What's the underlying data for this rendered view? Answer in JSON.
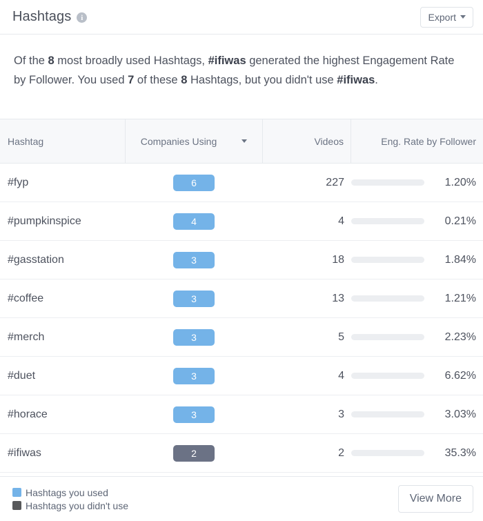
{
  "header": {
    "title": "Hashtags",
    "info_icon": "info-icon",
    "export_label": "Export",
    "export_caret": "chevron-down-icon"
  },
  "summary": {
    "part1": "Of the ",
    "count_total": "8",
    "part2": " most broadly used Hashtags, ",
    "top_hashtag": "#ifiwas",
    "part3": " generated the highest Engagement Rate by Follower. You used ",
    "count_used": "7",
    "part4": " of these ",
    "count_total2": "8",
    "part5": " Hashtags, but you didn't use ",
    "unused_hashtag": "#ifiwas",
    "part6": "."
  },
  "table": {
    "columns": [
      {
        "key": "hashtag",
        "label": "Hashtag"
      },
      {
        "key": "companies",
        "label": "Companies Using",
        "sorted": true,
        "sort_icon": "caret-down-icon"
      },
      {
        "key": "videos",
        "label": "Videos"
      },
      {
        "key": "eng",
        "label": "Eng. Rate by Follower"
      }
    ],
    "rows": [
      {
        "hashtag": "#fyp",
        "companies": "6",
        "used": true,
        "videos": "227",
        "eng": "1.20%",
        "eng_value": 1.2
      },
      {
        "hashtag": "#pumpkinspice",
        "companies": "4",
        "used": true,
        "videos": "4",
        "eng": "0.21%",
        "eng_value": 0.21
      },
      {
        "hashtag": "#gasstation",
        "companies": "3",
        "used": true,
        "videos": "18",
        "eng": "1.84%",
        "eng_value": 1.84
      },
      {
        "hashtag": "#coffee",
        "companies": "3",
        "used": true,
        "videos": "13",
        "eng": "1.21%",
        "eng_value": 1.21
      },
      {
        "hashtag": "#merch",
        "companies": "3",
        "used": true,
        "videos": "5",
        "eng": "2.23%",
        "eng_value": 2.23
      },
      {
        "hashtag": "#duet",
        "companies": "3",
        "used": true,
        "videos": "4",
        "eng": "6.62%",
        "eng_value": 6.62
      },
      {
        "hashtag": "#horace",
        "companies": "3",
        "used": true,
        "videos": "3",
        "eng": "3.03%",
        "eng_value": 3.03
      },
      {
        "hashtag": "#ifiwas",
        "companies": "2",
        "used": false,
        "videos": "2",
        "eng": "35.3%",
        "eng_value": 35.3
      }
    ],
    "eng_max": 35.3
  },
  "footer": {
    "legend": [
      {
        "label": "Hashtags you used",
        "color": "#74b3e8"
      },
      {
        "label": "Hashtags you didn't use",
        "color": "#58595b"
      }
    ],
    "view_more_label": "View More"
  },
  "colors": {
    "badge_used": "#74b3e8",
    "badge_unused": "#6b7285",
    "bar_fill": "#5c6377",
    "bar_track": "#eceef1",
    "text": "#4d525e",
    "header_bg": "#f7f8fa",
    "border": "#e6e9ed"
  },
  "chart_data": {
    "type": "bar",
    "title": "Eng. Rate by Follower",
    "categories": [
      "#fyp",
      "#pumpkinspice",
      "#gasstation",
      "#coffee",
      "#merch",
      "#duet",
      "#horace",
      "#ifiwas"
    ],
    "values": [
      1.2,
      0.21,
      1.84,
      1.21,
      2.23,
      6.62,
      3.03,
      35.3
    ],
    "xlabel": "Hashtag",
    "ylabel": "Eng. Rate by Follower (%)",
    "ylim": [
      0,
      35.3
    ],
    "grid": false,
    "legend_position": "bottom-left",
    "series": [
      {
        "name": "Companies Using",
        "values": [
          6,
          4,
          3,
          3,
          3,
          3,
          3,
          2
        ]
      },
      {
        "name": "Videos",
        "values": [
          227,
          4,
          18,
          13,
          5,
          4,
          3,
          2
        ]
      },
      {
        "name": "Eng. Rate by Follower",
        "values": [
          1.2,
          0.21,
          1.84,
          1.21,
          2.23,
          6.62,
          3.03,
          35.3
        ]
      }
    ]
  }
}
